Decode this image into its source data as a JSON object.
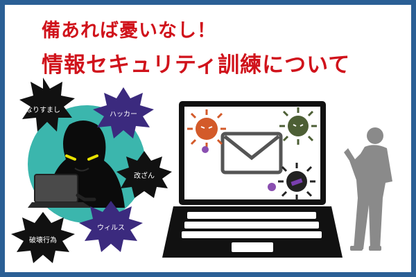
{
  "header": {
    "line1": "備あれば憂いなし！",
    "line2": "情報セキュリティ訓練について"
  },
  "threats": {
    "impersonation": "なりすまし",
    "hacker": "ハッカー",
    "tampering": "改ざん",
    "virus": "ウィルス",
    "destruction": "破壊行為"
  },
  "colors": {
    "border": "#2a5f95",
    "title": "#d0121b",
    "teal_circle": "#3bb6ad",
    "burst_black": "#111111",
    "burst_purple": "#3b2a7e",
    "virus_orange": "#d35a2a",
    "virus_green": "#4d5f35",
    "person_gray": "#8a8a8a"
  }
}
